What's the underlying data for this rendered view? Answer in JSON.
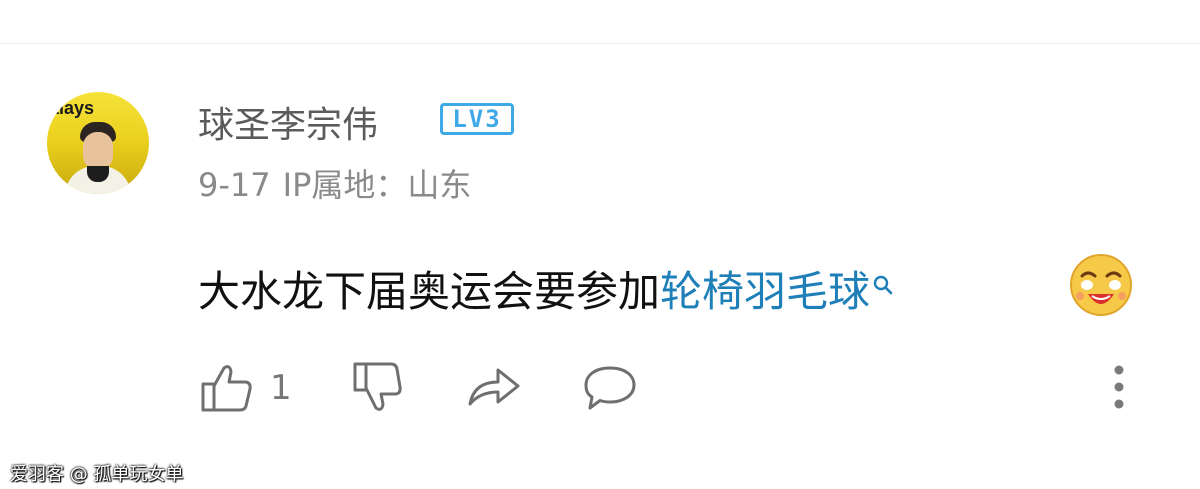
{
  "comment_card": {
    "username": "球圣李宗伟",
    "level_badge": "LV3",
    "date": "9-17",
    "ip_location": "IP属地：山东",
    "comment_text": "大水龙下届奥运会要参加",
    "comment_link": "轮椅羽毛球",
    "like_count": "1"
  },
  "avatar_text": "alays",
  "icons": [
    "thumbs-up-icon",
    "thumbs-down-icon",
    "share-icon",
    "comment-icon",
    "more-vertical-icon",
    "search-icon",
    "laughing-emoji-icon"
  ],
  "colors": {
    "link": "#1f7fb8",
    "badge": "#3fa8e6",
    "text_gray": "#8a8a8a"
  },
  "watermark": "爱羽客 @ 孤单玩女单"
}
